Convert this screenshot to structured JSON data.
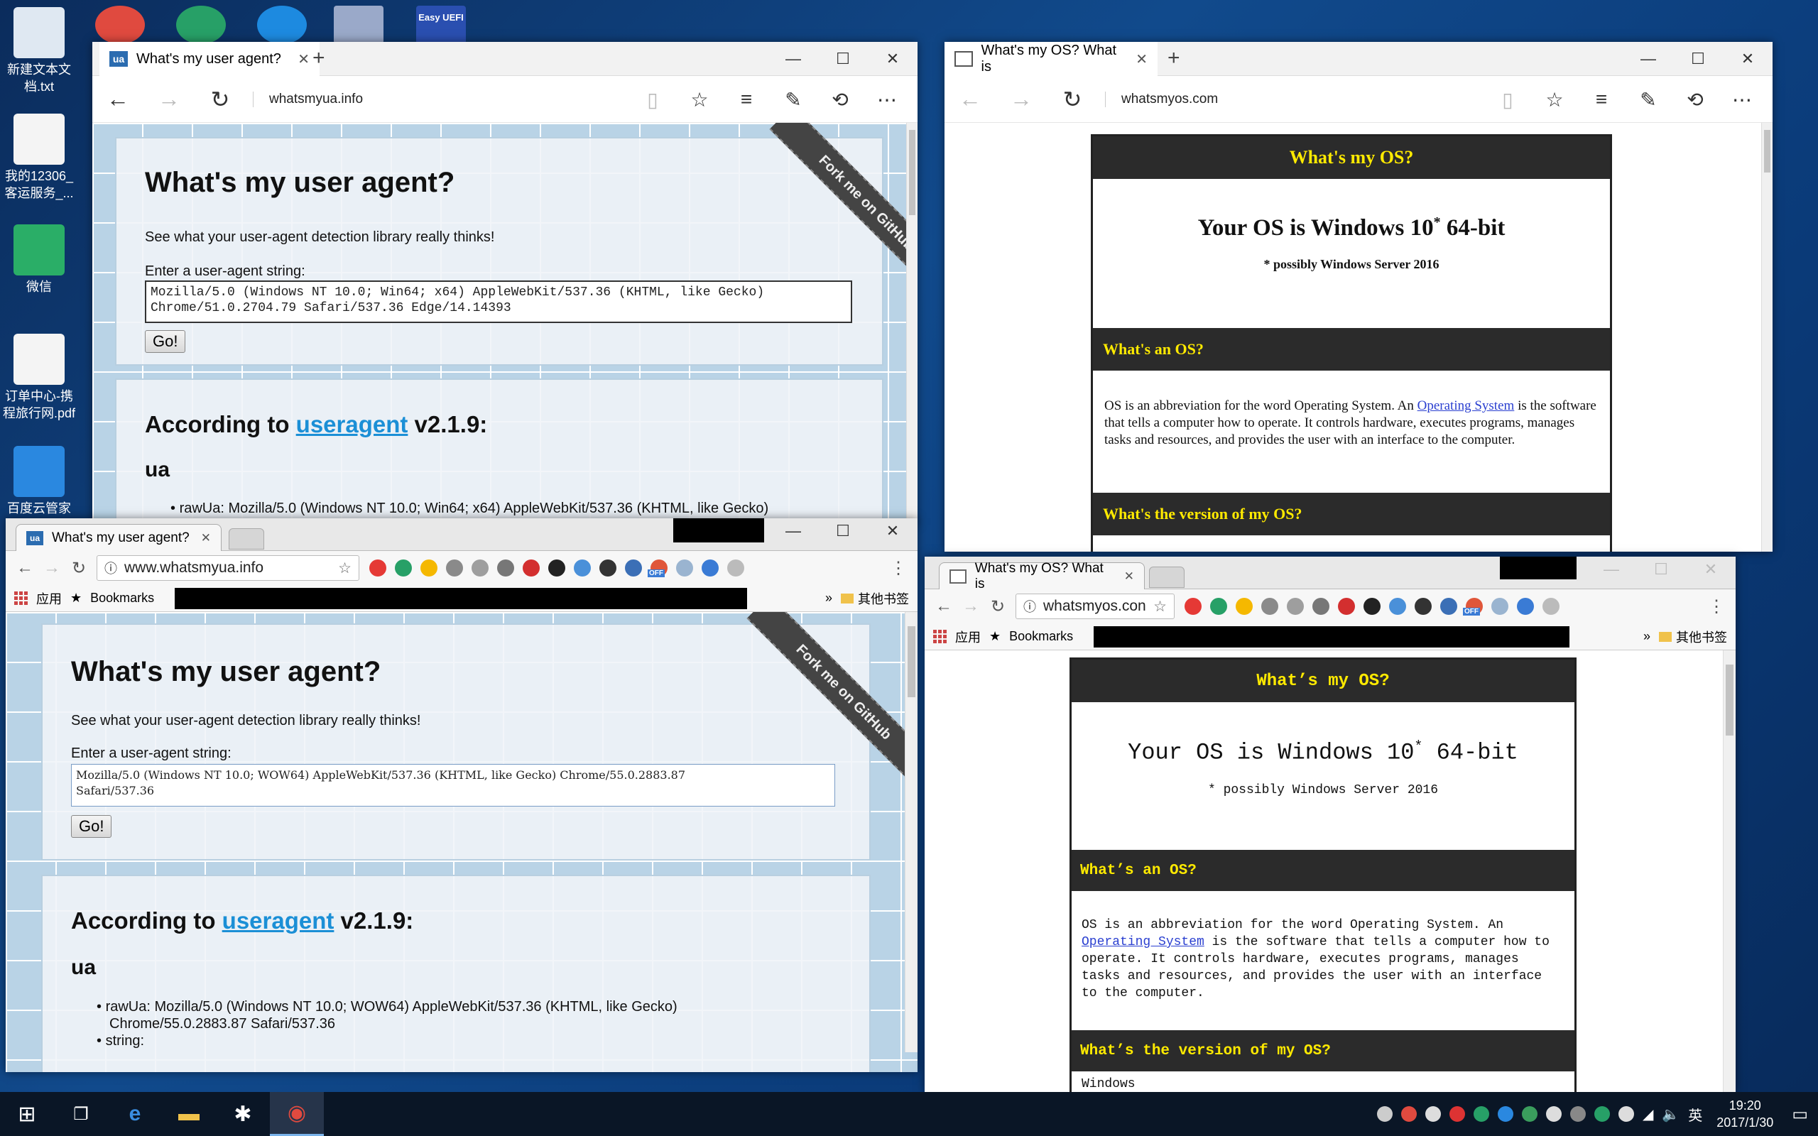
{
  "desktop": {
    "icons": [
      {
        "label": "新建文本文档.txt",
        "color": "#dfe8f2"
      },
      {
        "label": "我的12306_客运服务_...",
        "color": "#f4f4f4"
      },
      {
        "label": "微信",
        "color": "#2aae67"
      },
      {
        "label": "订单中心-携程旅行网.pdf",
        "color": "#f4f4f4"
      },
      {
        "label": "百度云管家",
        "color": "#2a88e0"
      }
    ],
    "top_icons": [
      {
        "name": "chrome-desktop-icon",
        "color": "#e04a3f"
      },
      {
        "name": "app-desktop-icon",
        "color": "#27a067"
      },
      {
        "name": "fruit-desktop-icon",
        "color": "#1d8ae0"
      },
      {
        "name": "image-desktop-icon",
        "color": "#9aa9c9"
      },
      {
        "name": "easyuefi-desktop-icon",
        "color": "#2a4fb0"
      }
    ],
    "top_icon_easyuefi_text": "Easy UEFI"
  },
  "edge_ua": {
    "tab_title": "What's my user agent?",
    "favicon": "ua",
    "url": "whatsmyua.info",
    "page": {
      "heading": "What's my user agent?",
      "subtitle": "See what your user-agent detection library really thinks!",
      "input_label": "Enter a user-agent string:",
      "ua_line1": "Mozilla/5.0 (Windows NT 10.0; Win64; x64) AppleWebKit/537.36 (KHTML, like Gecko)",
      "ua_line2": "Chrome/51.0.2704.79 Safari/537.36 Edge/14.14393",
      "go": "Go!",
      "according_pre": "According to ",
      "according_link": "useragent",
      "according_post": " v2.1.9:",
      "section": "ua",
      "raw_item": "rawUa: Mozilla/5.0 (Windows NT 10.0; Win64; x64) AppleWebKit/537.36 (KHTML, like Gecko)",
      "ribbon": "Fork me on GitHub"
    }
  },
  "edge_os": {
    "tab_title": "What's my OS? What is",
    "url": "whatsmyos.com",
    "page": {
      "bar1": "What's my OS?",
      "result_pre": "Your OS is Windows 10",
      "result_sup": "*",
      "result_post": " 64-bit",
      "note": "* possibly Windows Server 2016",
      "bar2": "What's an OS?",
      "desc_pre": "OS is an abbreviation for the word Operating System. An ",
      "desc_link": "Operating System",
      "desc_post": " is the software that tells a computer how to operate. It controls hardware, executes programs, manages tasks and resources, and provides the user with an interface to the computer.",
      "bar3": "What's the version of my OS?"
    }
  },
  "chrome_ua": {
    "tab_title": "What's my user agent?",
    "favicon": "ua",
    "url": "www.whatsmyua.info",
    "bookmarks": {
      "apps": "应用",
      "bookmarks": "Bookmarks",
      "more": "»",
      "other": "其他书签"
    },
    "page": {
      "heading": "What's my user agent?",
      "subtitle": "See what your user-agent detection library really thinks!",
      "input_label": "Enter a user-agent string:",
      "ua_line1": "Mozilla/5.0 (Windows NT 10.0; WOW64) AppleWebKit/537.36 (KHTML, like Gecko) Chrome/55.0.2883.87",
      "ua_line2": "Safari/537.36",
      "go": "Go!",
      "according_pre": "According to ",
      "according_link": "useragent",
      "according_post": " v2.1.9:",
      "section": "ua",
      "raw_item1": "rawUa: Mozilla/5.0 (Windows NT 10.0; WOW64) AppleWebKit/537.36 (KHTML, like Gecko)",
      "raw_item2": "Chrome/55.0.2883.87 Safari/537.36",
      "string_item": "string:",
      "ribbon": "Fork me on GitHub"
    }
  },
  "chrome_os": {
    "tab_title": "What's my OS? What is",
    "url": "whatsmyos.con",
    "bookmarks": {
      "apps": "应用",
      "bookmarks": "Bookmarks",
      "more": "»",
      "other": "其他书签"
    },
    "page": {
      "bar1": "What’s my OS?",
      "result_pre": "Your OS is Windows 10",
      "result_sup": "*",
      "result_post": " 64-bit",
      "note": "* possibly Windows Server 2016",
      "bar2": "What’s an OS?",
      "desc_pre": "OS is an abbreviation for the word Operating System. An ",
      "desc_link": "Operating System",
      "desc_post": " is the software that tells a computer how to operate. It controls hardware, executes programs, manages tasks and resources, and provides the user with an interface to the computer.",
      "bar3": "What’s the version of my OS?",
      "cutoff": "Windows"
    }
  },
  "chrome_extensions": [
    "#e53935",
    "#27a067",
    "#f5b800",
    "#8a8a8a",
    "#9e9e9e",
    "#777777",
    "#d32f2f",
    "#222222",
    "#4a90d9",
    "#333333",
    "#3b6fb6",
    "#e0563a",
    "#9ab4d0",
    "#3a7bd5",
    "#bbbbbb"
  ],
  "ext_off_badge": "OFF",
  "taskbar": {
    "time": "19:20",
    "date": "2017/1/30",
    "ime": "英",
    "tray_colors": [
      "#cccccc",
      "#e04a3f",
      "#dddddd",
      "#d33",
      "#27a067",
      "#2a88e0",
      "#3a9d5d",
      "#dddddd",
      "#888888",
      "#27a067",
      "#dddddd"
    ]
  },
  "colors": {
    "accent_link": "#1b8fd6",
    "os_bar_bg": "#2b2b2b",
    "os_bar_text": "#ffea00",
    "os_link": "#2a3fd0"
  }
}
